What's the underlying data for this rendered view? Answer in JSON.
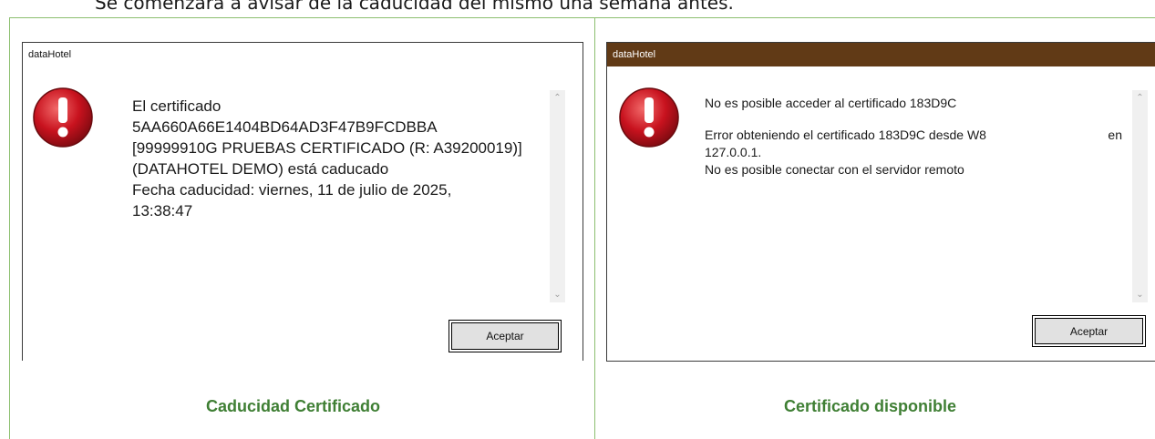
{
  "page": {
    "top_text": "Se comenzará a avisar de la caducidad del mismo una semana antes."
  },
  "colors": {
    "cell_border": "#8cbf6f",
    "caption": "#3f7f34",
    "dialog2_titlebar": "#613a16",
    "icon_red": "#c8121e"
  },
  "dialogs": [
    {
      "title": "dataHotel",
      "icon": "error-icon",
      "message_lines": [
        "El certificado",
        "5AA660A66E1404BD64AD3F47B9FCDBBA",
        "[99999910G PRUEBAS CERTIFICADO (R: A39200019)]",
        "(DATAHOTEL DEMO) está caducado",
        "Fecha caducidad: viernes, 11 de julio de 2025,",
        "13:38:47"
      ],
      "button_label": "Aceptar",
      "caption": "Caducidad Certificado"
    },
    {
      "title": "dataHotel",
      "icon": "error-icon",
      "message_first": "No es posible acceder al certificado 183D9C",
      "message_error_a": "Error obteniendo el certificado 183D9C desde W8",
      "message_error_b": "en",
      "message_rest": [
        "127.0.0.1.",
        "No es posible conectar con el servidor remoto"
      ],
      "button_label": "Aceptar",
      "caption": "Certificado disponible"
    }
  ]
}
